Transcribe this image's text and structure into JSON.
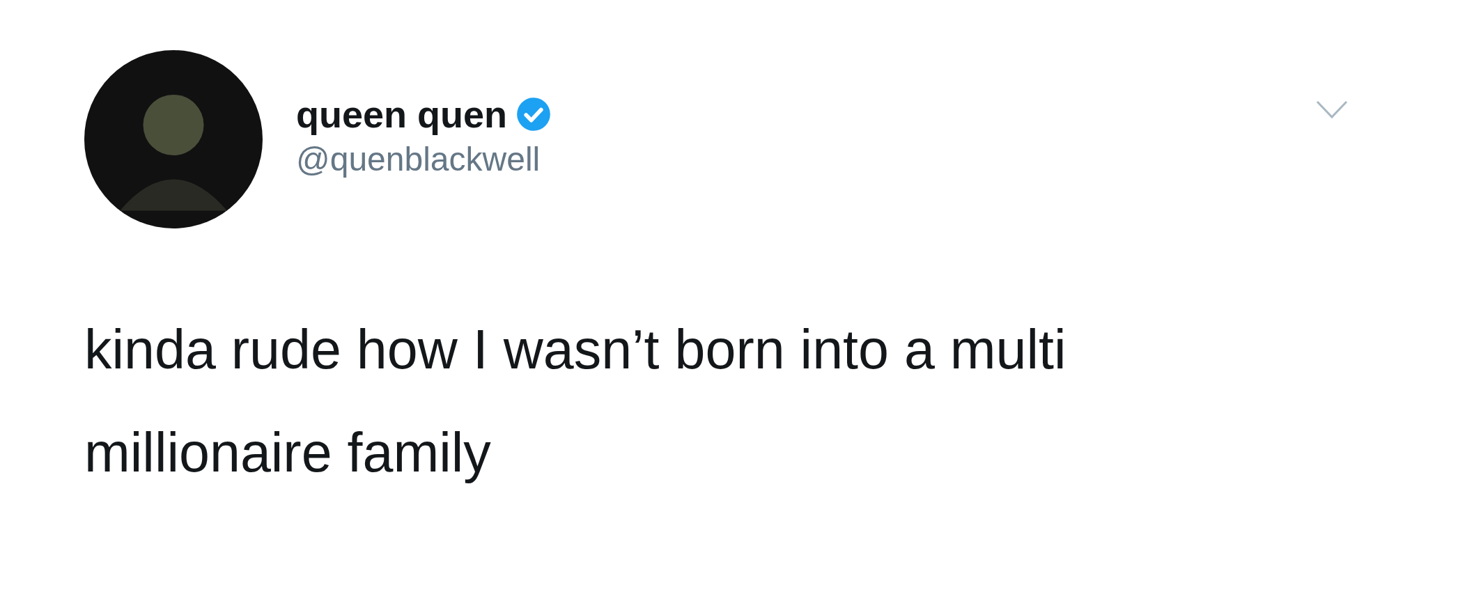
{
  "tweet": {
    "author": {
      "name": "queen quen",
      "verified": true,
      "handle": "@quenblackwell"
    },
    "text_lines": [
      "kinda rude how I wasn’t born into a multi",
      "millionaire family"
    ]
  }
}
